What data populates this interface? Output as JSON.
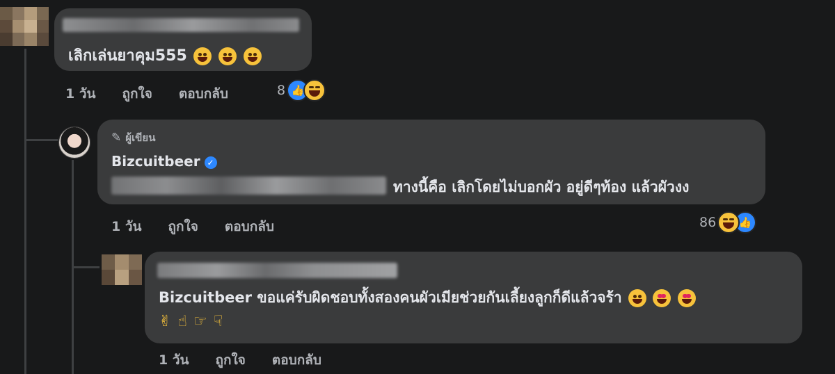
{
  "comments": [
    {
      "id": "c1",
      "text": "เลิกเล่นยาคุม555",
      "time": "1 วัน",
      "like": "ถูกใจ",
      "reply": "ตอบกลับ",
      "reaction_count": "8"
    },
    {
      "id": "c2",
      "badge": "ผู้เขียน",
      "author": "Bizcuitbeer",
      "text": "ทางนี้คือ เลิกโดยไม่บอกผัว อยู่ดีๆท้อง แล้วผัวงง",
      "time": "1 วัน",
      "like": "ถูกใจ",
      "reply": "ตอบกลับ",
      "reaction_count": "86"
    },
    {
      "id": "c3",
      "mention": "Bizcuitbeer",
      "text": " ขอแค่รับผิดชอบทั้งสองคนผัวเมียช่วยกันเลี้ยงลูกก็ดีแล้วจร้า",
      "time": "1 วัน",
      "like": "ถูกใจ",
      "reply": "ตอบกลับ"
    }
  ],
  "icons": {
    "pencil": "pencil-icon",
    "verified": "verified-badge-icon",
    "like": "like-reaction-icon",
    "haha": "haha-reaction-icon"
  },
  "colors": {
    "background": "#18191a",
    "bubble": "#3a3b3c",
    "secondary_text": "#b0b3b8",
    "like_blue": "#2d88ff"
  }
}
